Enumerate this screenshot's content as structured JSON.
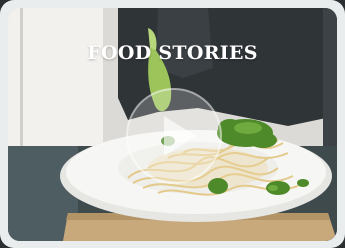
{
  "video": {
    "title": "FOOD STORIES",
    "play_icon": "play-icon",
    "colors": {
      "accent": "#ffffff",
      "sauce": "#5a8f2e",
      "plate": "#f4f4f2",
      "board": "#c6a878"
    }
  }
}
